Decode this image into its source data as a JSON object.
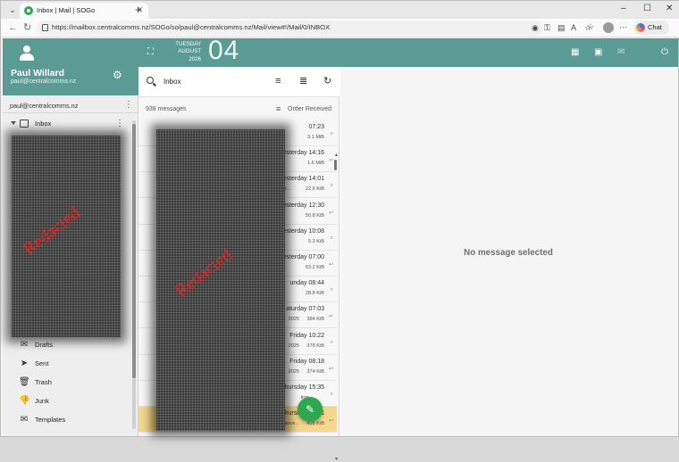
{
  "browser": {
    "tab_title": "Inbox | Mail | SOGo",
    "url": "https://mailbox.centralcomms.nz/SOGo/so/paul@centralcomms.nz/Mail/view#!/Mail/0/INBOX",
    "chat_label": "Chat"
  },
  "user": {
    "name": "Paul Willard",
    "email": "paul@centralcomms.nz"
  },
  "account": {
    "label": "paul@centralcomms.nz",
    "inbox_label": "Inbox",
    "redaction_text": "Redacted"
  },
  "folders": [
    {
      "label": "Drafts",
      "icon": "drafts-icon"
    },
    {
      "label": "Sent",
      "icon": "sent-icon"
    },
    {
      "label": "Trash",
      "icon": "trash-icon"
    },
    {
      "label": "Junk",
      "icon": "junk-icon"
    },
    {
      "label": "Templates",
      "icon": "templates-icon"
    }
  ],
  "date_header": {
    "weekday": "TUESDAY",
    "month": "AUGUST",
    "year": "2026",
    "day": "04"
  },
  "message_list": {
    "mailbox_name": "Inbox",
    "count_text": "938 messages",
    "order_label": "Order Received",
    "redaction_text": "Redacted",
    "visible_fragments": [
      "/ Or...",
      "2025",
      "2025",
      "2025",
      "tion -",
      "te ... 2025 Balance..."
    ],
    "messages": [
      {
        "date": "07:23",
        "size": "3.1 MiB"
      },
      {
        "date": "esterday 14:16",
        "size": "1.6 MiB"
      },
      {
        "date": "esterday 14:01",
        "size": "22.6 KiB"
      },
      {
        "date": "esterday 12:30",
        "size": "50.8 KiB"
      },
      {
        "date": "esterday 10:08",
        "size": "5.3 KiB"
      },
      {
        "date": "esterday 07:00",
        "size": "63.2 KiB"
      },
      {
        "date": "unday 08:44",
        "size": "28.8 KiB"
      },
      {
        "date": "aturday 07:03",
        "size": "384 KiB"
      },
      {
        "date": "Friday 10:22",
        "size": "378 KiB"
      },
      {
        "date": "Friday 08:18",
        "size": "374 KiB"
      },
      {
        "date": "hursday 15:35",
        "size": ""
      },
      {
        "date": "hursday 13:51",
        "size": "405 KiB"
      }
    ]
  },
  "reading_pane": {
    "empty_text": "No message selected"
  },
  "colors": {
    "header_teal": "#5a9b94",
    "accent_green": "#2ea84f",
    "selected_row": "#f5d78c"
  }
}
